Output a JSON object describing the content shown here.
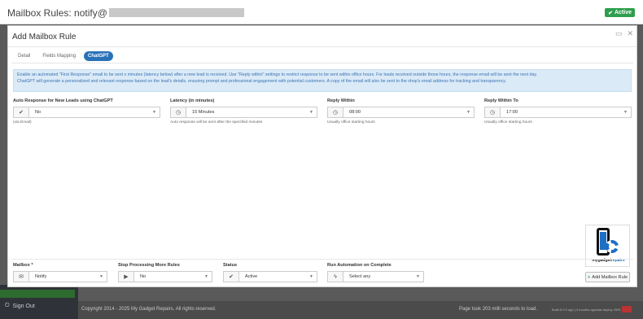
{
  "outer": {
    "title": "Mailbox Rules: notify@",
    "status_badge": "Active"
  },
  "background": {
    "sign_out": "Sign Out",
    "copyright": "Copyright 2014 - 2025 My Gadget Repairs. All rights reserved.",
    "load_time": "Page took 203 milli seconds to load.",
    "build": "Build 5.0.0 ago | 3 months ago/last deploy 2025"
  },
  "modal": {
    "title": "Add Mailbox Rule",
    "tabs": [
      {
        "label": "Detail",
        "active": false
      },
      {
        "label": "Fields Mapping",
        "active": false
      },
      {
        "label": "ChatGPT",
        "active": true
      }
    ],
    "alert_lines": [
      "Enable an automated \"First Response\" email to be sent x minutes (latency below) after a new lead is received. Use \"Reply within\" settings to restrict response to be sent within office hours. For leads received outside those hours, the response email will be sent the next day.",
      "ChatGPT will generate a personalized and relevant response based on the lead's details, ensuring prompt and professional engagement with potential customers. A copy of the email will also be sent to the shop's email address for tracking and transparency."
    ],
    "fields": {
      "auto_response": {
        "label": "Auto Response for New Leads using ChatGPT",
        "value": "No",
        "help": "(via Email)",
        "icon": "check-icon"
      },
      "latency": {
        "label": "Latency (in minutes)",
        "value": "15 Minutes",
        "help": "Auto response will be sent after the specified minutes",
        "icon": "clock-icon"
      },
      "reply_within": {
        "label": "Reply Within",
        "value": "08:00",
        "help": "Usually office starting hours",
        "icon": "clock-icon"
      },
      "reply_within_to": {
        "label": "Reply Within To",
        "value": "17:00",
        "help": "Usually office starting hours",
        "icon": "clock-icon"
      }
    },
    "footer": {
      "mailbox": {
        "label": "Mailbox *",
        "value": "Notify",
        "icon": "envelope-icon"
      },
      "stop_processing": {
        "label": "Stop Processing More Rules",
        "value": "No",
        "icon": "play-icon"
      },
      "status": {
        "label": "Status",
        "value": "Active",
        "icon": "check-icon"
      },
      "run_automation": {
        "label": "Run Automation on Complete",
        "value": "Select any",
        "icon": "bolt-icon"
      }
    },
    "logo": {
      "brand": "mygadget",
      "brand_accent": "repairs"
    },
    "add_button": "Add Mailbox Rule"
  },
  "colors": {
    "primary": "#2a72b8",
    "success": "#2e9f4e",
    "alert_bg": "#dbeaf7"
  }
}
